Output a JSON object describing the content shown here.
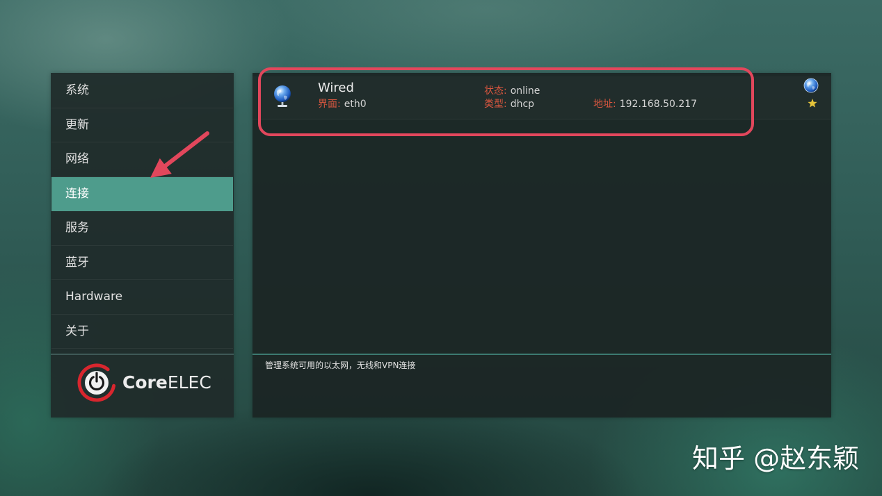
{
  "colors": {
    "accent": "#4e9c8c",
    "field_label": "#d9563f",
    "annotation": "#e2475c",
    "favorite_star": "#e6c43a",
    "divider": "#3c7a70"
  },
  "sidebar": {
    "items": [
      {
        "label": "系统",
        "selected": false
      },
      {
        "label": "更新",
        "selected": false
      },
      {
        "label": "网络",
        "selected": false
      },
      {
        "label": "连接",
        "selected": true
      },
      {
        "label": "服务",
        "selected": false
      },
      {
        "label": "蓝牙",
        "selected": false
      },
      {
        "label": "Hardware",
        "selected": false
      },
      {
        "label": "关于",
        "selected": false
      }
    ],
    "logo": {
      "icon": "power-icon",
      "text_primary": "Core",
      "text_secondary": "ELEC"
    }
  },
  "connection": {
    "icon": "network-globe-icon",
    "name": "Wired",
    "interface": {
      "label": "界面:",
      "value": "eth0"
    },
    "state": {
      "label": "状态:",
      "value": "online"
    },
    "type": {
      "label": "类型:",
      "value": "dhcp"
    },
    "address": {
      "label": "地址:",
      "value": "192.168.50.217"
    },
    "status_icon": "globe-icon",
    "favorite_icon": "star-icon"
  },
  "footer": {
    "description": "管理系统可用的以太网，无线和VPN连接"
  },
  "watermark": {
    "text": "知乎 @赵东颖"
  }
}
